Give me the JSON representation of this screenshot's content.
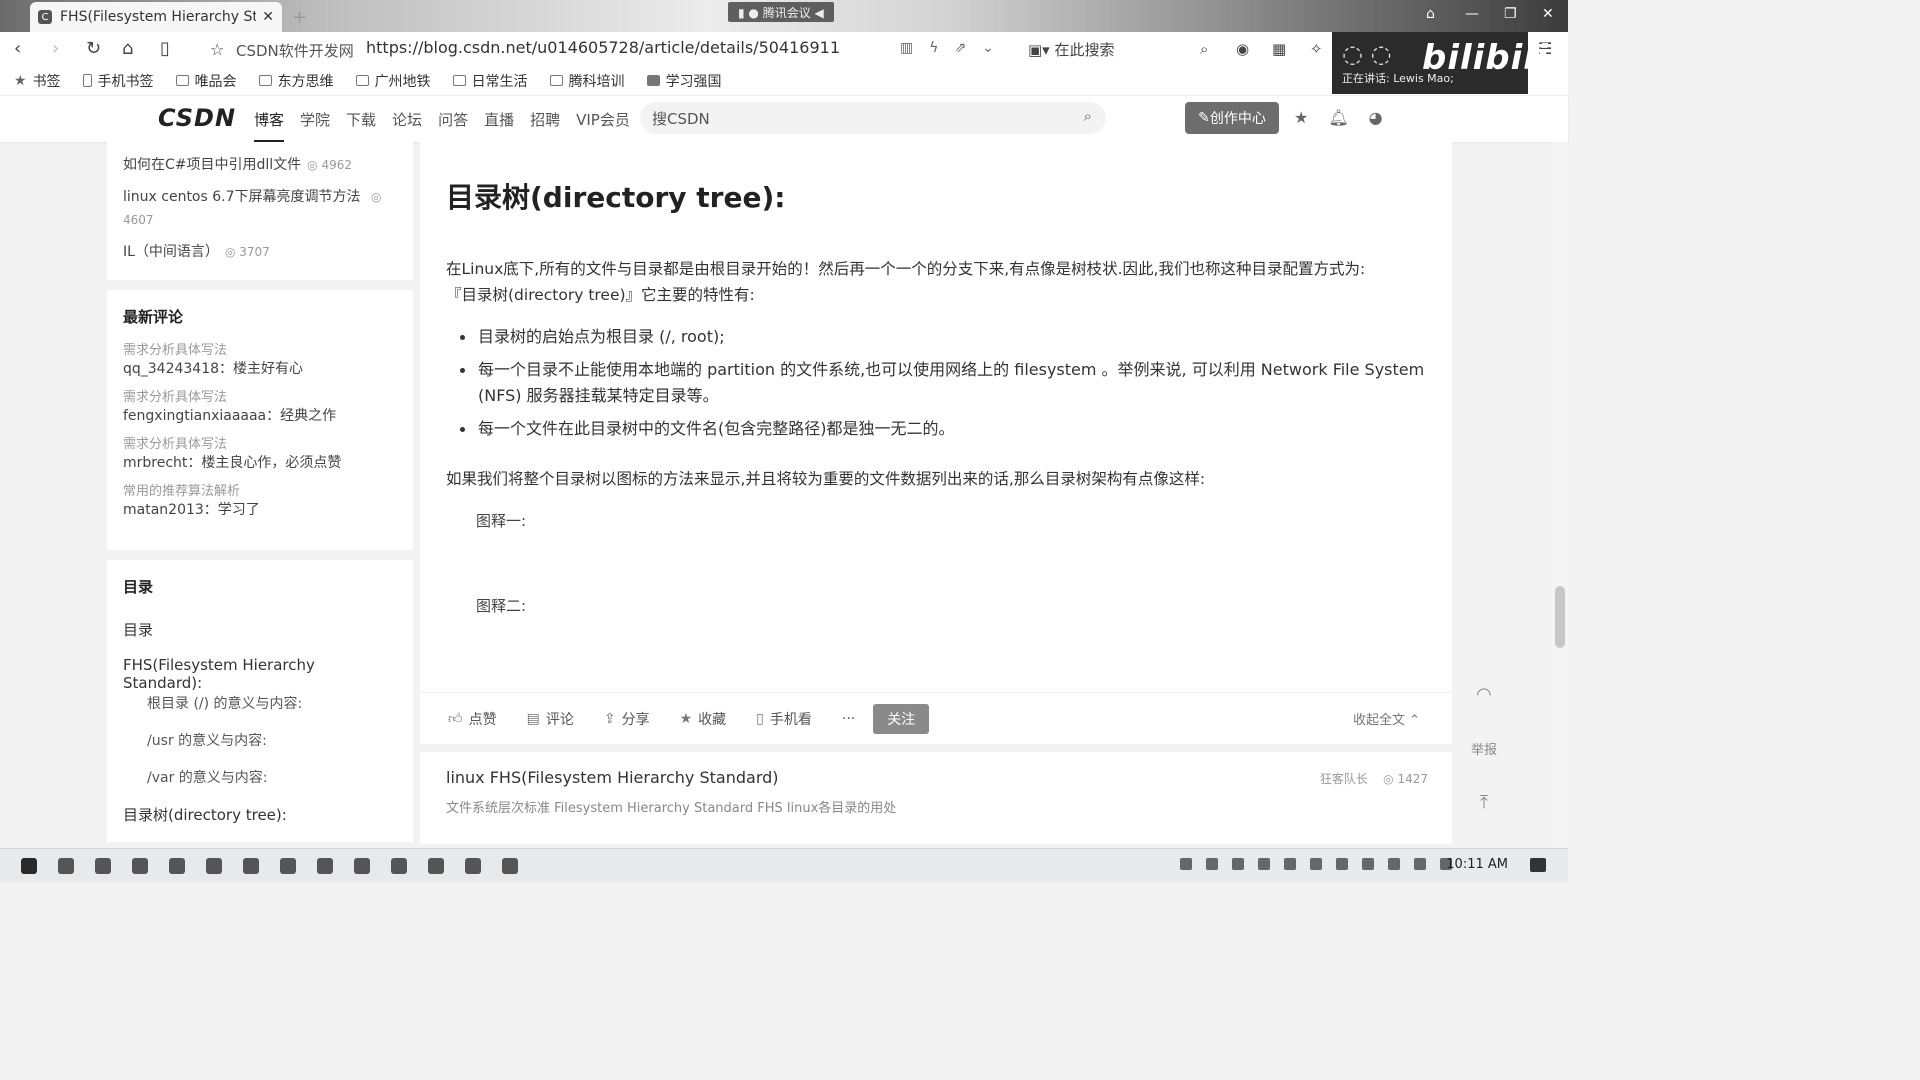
{
  "browser": {
    "tab_title": "FHS(Filesystem Hierarchy Sta",
    "meeting_label": "腾讯会议",
    "site_name": "CSDN软件开发网",
    "url": "https://blog.csdn.net/u014605728/article/details/50416911",
    "search_here": "在此搜索",
    "bookmarks": [
      {
        "label": "书签",
        "icon": "star-icon"
      },
      {
        "label": "手机书签",
        "icon": "phone-icon"
      },
      {
        "label": "唯品会",
        "icon": "folder-icon"
      },
      {
        "label": "东方思维",
        "icon": "folder-icon"
      },
      {
        "label": "广州地铁",
        "icon": "folder-icon"
      },
      {
        "label": "日常生活",
        "icon": "folder-icon"
      },
      {
        "label": "腾科培训",
        "icon": "folder-icon"
      },
      {
        "label": "学习强国",
        "icon": "app-icon"
      }
    ]
  },
  "overlay": {
    "logo": "bilibili",
    "speaking": "正在讲话: Lewis Mao;"
  },
  "csdn": {
    "logo": "CSDN",
    "nav": [
      "博客",
      "学院",
      "下载",
      "论坛",
      "问答",
      "直播",
      "招聘",
      "VIP会员"
    ],
    "search_placeholder": "搜CSDN",
    "create_button": "创作中心"
  },
  "sidebar": {
    "popular": [
      {
        "title": "如何在C#项目中引用dll文件",
        "views": "4962"
      },
      {
        "title": "linux centos 6.7下屏幕亮度调节方法",
        "views": "4607"
      },
      {
        "title": "IL（中间语言）",
        "views": "3707"
      }
    ],
    "comments_title": "最新评论",
    "comments": [
      {
        "article": "需求分析具体写法",
        "text": "qq_34243418：楼主好有心"
      },
      {
        "article": "需求分析具体写法",
        "text": "fengxingtianxiaaaaa：经典之作"
      },
      {
        "article": "需求分析具体写法",
        "text": "mrbrecht：楼主良心作，必须点赞"
      },
      {
        "article": "常用的推荐算法解析",
        "text": "matan2013：学习了"
      }
    ],
    "toc_title": "目录",
    "toc": [
      {
        "label": "目录",
        "sub": false
      },
      {
        "label": "FHS(Filesystem Hierarchy Standard):",
        "sub": false
      },
      {
        "label": "根目录 (/) 的意义与内容:",
        "sub": true
      },
      {
        "label": "/usr 的意义与内容:",
        "sub": true
      },
      {
        "label": "/var 的意义与内容:",
        "sub": true
      },
      {
        "label": "目录树(directory tree):",
        "sub": false
      }
    ]
  },
  "article": {
    "heading": "目录树(directory tree):",
    "intro_line1": "在Linux底下,所有的文件与目录都是由根目录开始的！然后再一个一个的分支下来,有点像是树枝状.因此,我们也称这种目录配置方式为:",
    "intro_line2": "『目录树(directory tree)』它主要的特性有:",
    "bullets": [
      "目录树的启始点为根目录 (/, root);",
      "每一个目录不止能使用本地端的 partition 的文件系统,也可以使用网络上的 filesystem 。举例来说, 可以利用 Network File System (NFS) 服务器挂载某特定目录等。",
      "每一个文件在此目录树中的文件名(包含完整路径)都是独一无二的。"
    ],
    "summary": "如果我们将整个目录树以图标的方法来显示,并且将较为重要的文件数据列出来的话,那么目录树架构有点像这样:",
    "fig1": "图释一:",
    "fig2": "图释二:"
  },
  "actions": {
    "like": "点赞",
    "comment": "评论",
    "share": "分享",
    "favorite": "收藏",
    "mobile": "手机看",
    "more": "···",
    "follow": "关注",
    "collapse": "收起全文"
  },
  "related": {
    "title": "linux FHS(Filesystem Hierarchy Standard)",
    "desc": "文件系统层次标准 Filesystem Hierarchy Standard FHS linux各目录的用处",
    "author": "狂客队长",
    "views": "1427"
  },
  "float_tools": {
    "report": "举报"
  },
  "taskbar": {
    "time": "10:11 AM"
  }
}
